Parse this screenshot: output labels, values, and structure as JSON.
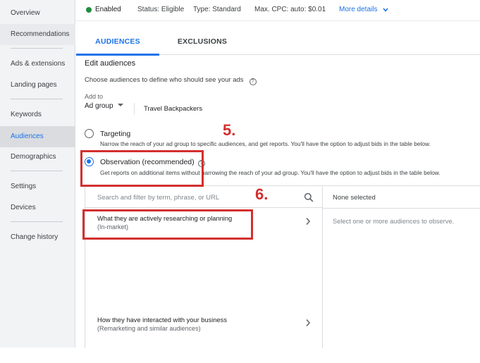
{
  "sidebar": {
    "items": [
      {
        "label": "Overview"
      },
      {
        "label": "Recommendations"
      },
      {
        "label": "Ads & extensions"
      },
      {
        "label": "Landing pages"
      },
      {
        "label": "Keywords"
      },
      {
        "label": "Audiences",
        "active": true
      },
      {
        "label": "Demographics"
      },
      {
        "label": "Settings"
      },
      {
        "label": "Devices"
      },
      {
        "label": "Change history"
      }
    ]
  },
  "status_bar": {
    "status": "Enabled",
    "status_color": "#1e8e3e",
    "status_eligible": "Status: Eligible",
    "type": "Type: Standard",
    "max_cpc": "Max. CPC: auto: $0.01",
    "more_details": "More details"
  },
  "tabs": [
    {
      "label": "AUDIENCES",
      "active": true
    },
    {
      "label": "EXCLUSIONS"
    }
  ],
  "edit": {
    "title": "Edit audiences",
    "subtitle": "Choose audiences to define who should see your ads",
    "add_to_label": "Add to",
    "add_to_value": "Ad group",
    "ad_group_name": "Travel Backpackers"
  },
  "options": {
    "targeting": {
      "title": "Targeting",
      "desc": "Narrow the reach of your ad group to specific audiences, and get reports. You'll have the option to adjust bids in the table below.",
      "selected": false
    },
    "observation": {
      "title": "Observation (recommended)",
      "desc": "Get reports on additional items without narrowing the reach of your ad group. You'll have the option to adjust bids in the table below.",
      "selected": true
    }
  },
  "picker": {
    "search_placeholder": "Search and filter by term, phrase, or URL",
    "categories": [
      {
        "title": "What they are actively researching or planning",
        "subtitle": "(In-market)"
      },
      {
        "title": "How they have interacted with your business",
        "subtitle": "(Remarketing and similar audiences)"
      }
    ],
    "selected_header": "None selected",
    "selected_empty": "Select one or more audiences to observe."
  },
  "annotations": {
    "step5": "5.",
    "step6": "6.",
    "color": "#d32f2f"
  },
  "colors": {
    "accent": "#1a73e8"
  }
}
